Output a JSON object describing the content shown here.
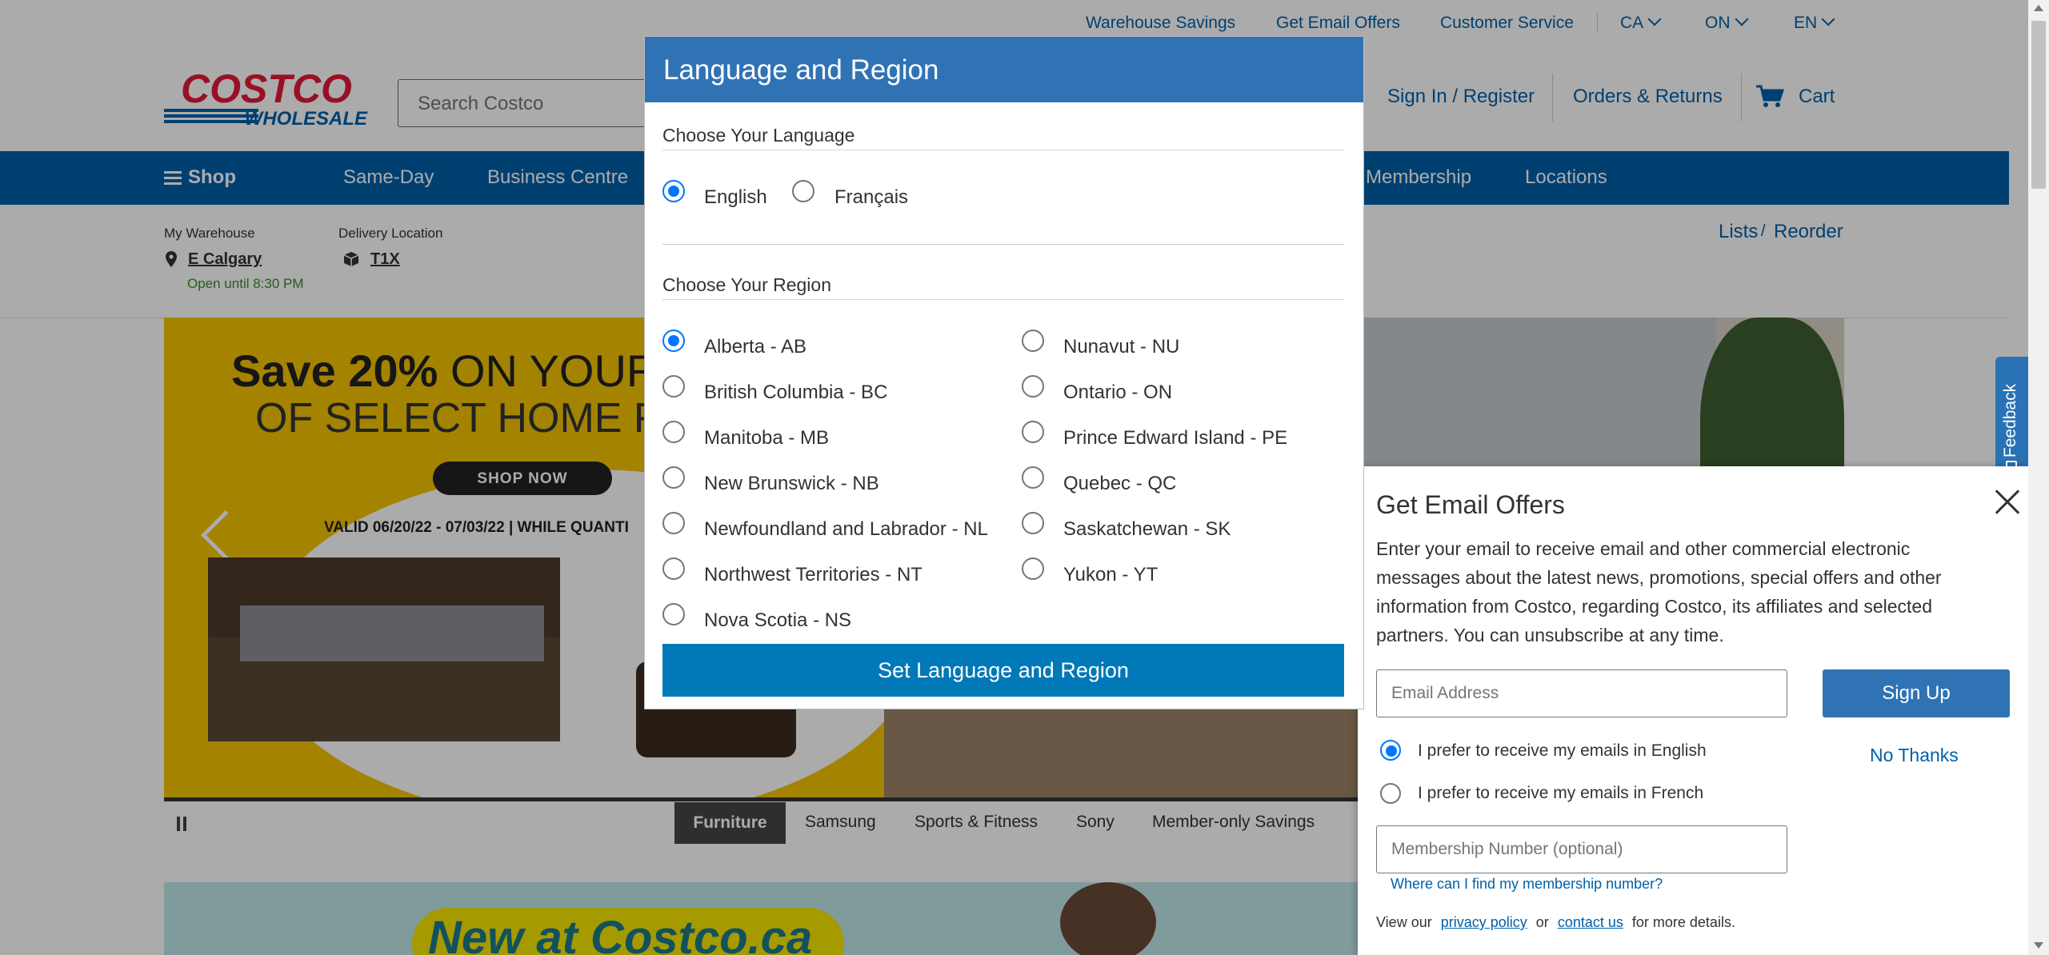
{
  "utility_bar": {
    "warehouse_savings": "Warehouse Savings",
    "email_offers": "Get Email Offers",
    "customer_service": "Customer Service",
    "country": "CA",
    "province": "ON",
    "language": "EN"
  },
  "header": {
    "logo_top": "COSTCO",
    "logo_bottom": "WHOLESALE",
    "search_placeholder": "Search Costco",
    "sign_in": "Sign In / Register",
    "orders": "Orders & Returns",
    "cart": "Cart"
  },
  "nav": {
    "shop": "Shop",
    "items": [
      "Same-Day",
      "Business Centre",
      "Membership",
      "Locations"
    ]
  },
  "warehouse": {
    "label": "My Warehouse",
    "name": "E Calgary",
    "hours": "Open until 8:30 PM",
    "delivery_label": "Delivery Location",
    "postal": "T1X",
    "lists": "Lists",
    "reorder": "Reorder"
  },
  "hero": {
    "headline_bold": "Save 20%",
    "headline_rest": "ON YOUR PU",
    "headline_line2": "OF SELECT HOME FUR",
    "shop_now": "SHOP NOW",
    "valid": "VALID 06/20/22 - 07/03/22 | WHILE QUANTI"
  },
  "carousel_tabs": [
    "Furniture",
    "Samsung",
    "Sports & Fitness",
    "Sony",
    "Member-only Savings"
  ],
  "promo_banner": "New at Costco.ca",
  "modal": {
    "title": "Language and Region",
    "language_heading": "Choose Your Language",
    "languages": [
      {
        "label": "English",
        "selected": true
      },
      {
        "label": "Français",
        "selected": false
      }
    ],
    "region_heading": "Choose Your Region",
    "regions_left": [
      {
        "label": "Alberta - AB",
        "selected": true
      },
      {
        "label": "British Columbia - BC",
        "selected": false
      },
      {
        "label": "Manitoba - MB",
        "selected": false
      },
      {
        "label": "New Brunswick - NB",
        "selected": false
      },
      {
        "label": "Newfoundland and Labrador - NL",
        "selected": false
      },
      {
        "label": "Northwest Territories - NT",
        "selected": false
      },
      {
        "label": "Nova Scotia - NS",
        "selected": false
      }
    ],
    "regions_right": [
      {
        "label": "Nunavut - NU",
        "selected": false
      },
      {
        "label": "Ontario - ON",
        "selected": false
      },
      {
        "label": "Prince Edward Island - PE",
        "selected": false
      },
      {
        "label": "Quebec - QC",
        "selected": false
      },
      {
        "label": "Saskatchewan - SK",
        "selected": false
      },
      {
        "label": "Yukon - YT",
        "selected": false
      }
    ],
    "submit": "Set Language and Region"
  },
  "email_panel": {
    "title": "Get Email Offers",
    "body_lines": [
      "Enter your email to receive email and other commercial electronic",
      "messages about the latest news, promotions, special offers and other",
      "information from Costco, regarding Costco, its affiliates and selected",
      "partners. You can unsubscribe at any time."
    ],
    "email_placeholder": "Email Address",
    "sign_up": "Sign Up",
    "pref_english": "I prefer to receive my emails in English",
    "pref_french": "I prefer to receive my emails in French",
    "no_thanks": "No Thanks",
    "membership_placeholder": "Membership Number (optional)",
    "find_membership": "Where can I find my membership number?",
    "footer_pre": "View our",
    "privacy": "privacy policy",
    "footer_or": "or",
    "contact": "contact us",
    "footer_post": "for more details."
  },
  "feedback": "Feedback",
  "colors": {
    "brand_blue": "#0060a9",
    "modal_header": "#3073b5",
    "button_blue": "#0179b8",
    "radio_selected": "#0075ff",
    "logo_red": "#e31837"
  }
}
